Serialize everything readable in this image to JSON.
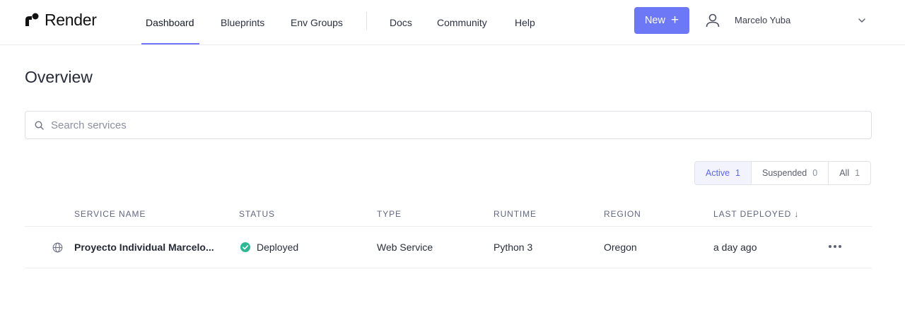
{
  "brand": {
    "name": "Render"
  },
  "nav": {
    "items": [
      {
        "label": "Dashboard",
        "active": true
      },
      {
        "label": "Blueprints",
        "active": false
      },
      {
        "label": "Env Groups",
        "active": false
      },
      {
        "label": "Docs",
        "active": false
      },
      {
        "label": "Community",
        "active": false
      },
      {
        "label": "Help",
        "active": false
      }
    ]
  },
  "header": {
    "new_button": "New",
    "user_name": "Marcelo Yuba"
  },
  "page": {
    "title": "Overview"
  },
  "search": {
    "placeholder": "Search services",
    "value": ""
  },
  "filters": [
    {
      "label": "Active",
      "count": "1",
      "active": true
    },
    {
      "label": "Suspended",
      "count": "0",
      "active": false
    },
    {
      "label": "All",
      "count": "1",
      "active": false
    }
  ],
  "table": {
    "columns": [
      "SERVICE NAME",
      "STATUS",
      "TYPE",
      "RUNTIME",
      "REGION",
      "LAST DEPLOYED ↓"
    ],
    "rows": [
      {
        "service_name": "Proyecto Individual Marcelo...",
        "status": "Deployed",
        "type": "Web Service",
        "runtime": "Python 3",
        "region": "Oregon",
        "last_deployed": "a day ago"
      }
    ]
  },
  "colors": {
    "accent": "#6c78f5",
    "status_ok": "#2fb896",
    "text": "#262a38"
  },
  "icons": {
    "logo": "render-logo-icon",
    "plus": "plus-icon",
    "avatar": "user-icon",
    "chevron": "chevron-down-icon",
    "search": "search-icon",
    "globe": "globe-icon",
    "status": "check-circle-icon",
    "more": "more-horizontal-icon"
  }
}
